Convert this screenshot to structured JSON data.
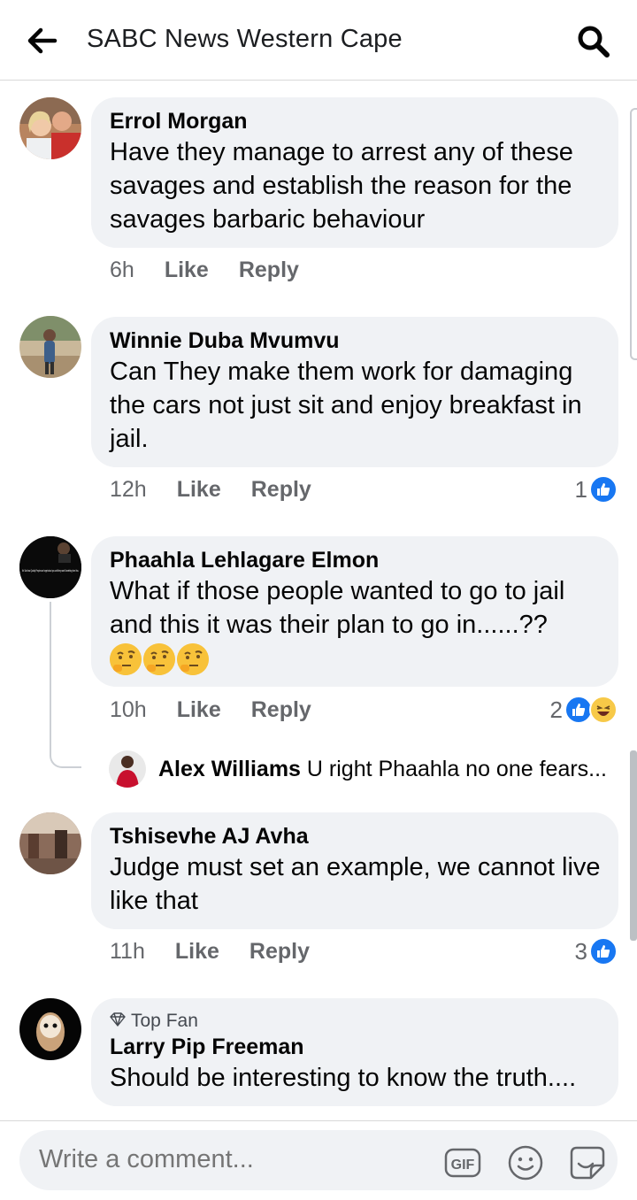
{
  "header": {
    "title": "SABC News Western Cape"
  },
  "comments": [
    {
      "name": "Errol Morgan",
      "text": "Have they manage to arrest any of these savages and establish the reason for the savages barbaric behaviour",
      "time": "6h",
      "like": "Like",
      "reply": "Reply"
    },
    {
      "name": "Winnie Duba Mvumvu",
      "text": "Can They make them work for damaging the cars not just sit and enjoy breakfast in jail.",
      "time": "12h",
      "like": "Like",
      "reply": "Reply",
      "reactions": "1"
    },
    {
      "name": "Phaahla Lehlagare Elmon",
      "text": "What if those people wanted to go to jail and this  it was their plan to go in......??",
      "time": "10h",
      "like": "Like",
      "reply": "Reply",
      "reactions": "2",
      "avatar_text": "It's Sad how Quickly People can forget about you until they want Something from You."
    },
    {
      "name": "Tshisevhe AJ Avha",
      "text": "Judge must set an example,  we cannot live like that",
      "time": "11h",
      "like": "Like",
      "reply": "Reply",
      "reactions": "3"
    },
    {
      "badge": "Top Fan",
      "name": "Larry Pip Freeman",
      "text": "Should be interesting to know the truth...."
    }
  ],
  "reply_preview": {
    "name": "Alex Williams",
    "text": "U right Phaahla no one fears..."
  },
  "composer": {
    "placeholder": "Write a comment...",
    "gif_label": "GIF"
  },
  "colors": {
    "accent": "#1877f2",
    "bubble": "#f0f2f5",
    "muted": "#65676b"
  }
}
